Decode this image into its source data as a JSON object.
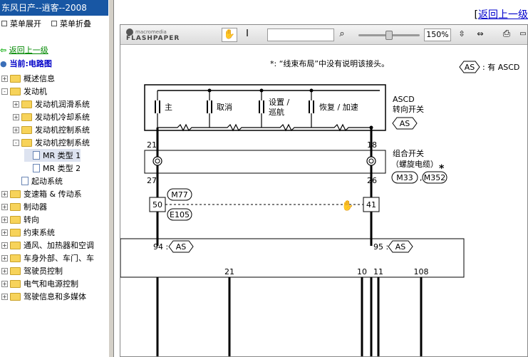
{
  "sidebar": {
    "title": "东风日产--逍客--2008",
    "expand_all": "菜单展开",
    "collapse_all": "菜单折叠",
    "back": "返回上一级",
    "current": "当前:电路图",
    "tree": [
      {
        "label": "概述信息",
        "sign": "+"
      },
      {
        "label": "发动机",
        "sign": "-"
      },
      {
        "label": "发动机润滑系统",
        "sign": "+"
      },
      {
        "label": "发动机冷却系统",
        "sign": "+"
      },
      {
        "label": "发动机控制系统",
        "sign": "+"
      },
      {
        "label": "发动机控制系统",
        "sign": "-"
      },
      {
        "label": "MR 类型 1"
      },
      {
        "label": "MR 类型 2"
      },
      {
        "label": "起动系统"
      },
      {
        "label": "变速箱 & 传动系",
        "sign": "+"
      },
      {
        "label": "制动器",
        "sign": "+"
      },
      {
        "label": "转向",
        "sign": "+"
      },
      {
        "label": "约束系统",
        "sign": "+"
      },
      {
        "label": "通风、加热器和空调",
        "sign": "+"
      },
      {
        "label": "车身外部、车门、车",
        "sign": "+"
      },
      {
        "label": "驾驶员控制",
        "sign": "+"
      },
      {
        "label": "电气和电源控制",
        "sign": "+"
      },
      {
        "label": "驾驶信息和多媒体",
        "sign": "+"
      }
    ]
  },
  "header": {
    "bracket": "[",
    "back_link": "返回上一级"
  },
  "flashpaper": {
    "logo_top": "macromedia",
    "logo_bottom": "FLASHPAPER",
    "zoom": "150%",
    "icons": [
      "hand-tool-icon",
      "text-select-icon",
      "search-icon",
      "fit-width-icon",
      "fit-page-icon",
      "print-icon"
    ]
  },
  "diagram": {
    "note": "*: “线束布局”中没有说明该接头。",
    "legend_tag": "AS",
    "legend_text": ": 有 ASCD",
    "switch_labels": [
      "主",
      "取消",
      "设置 /",
      "巡航",
      "恢复 / 加速"
    ],
    "ascd_label_1": "ASCD",
    "ascd_label_2": "转向开关",
    "ascd_tag": "AS",
    "combo_label_1": "组合开关",
    "combo_label_2": "（螺旋电缆）",
    "combo_conn_1": "M33",
    "combo_conn_2": "M352",
    "combo_star": "*",
    "pins_top": [
      "21",
      "18"
    ],
    "pins_bottom": [
      "27",
      "26"
    ],
    "conn_M77": "M77",
    "conn_E105": "E105",
    "term_left": "50",
    "term_right": "41",
    "ecm_left_pin": "94 :",
    "ecm_left_tag": "AS",
    "ecm_right_pin": "95 :",
    "ecm_right_tag": "AS",
    "bottom_pins": [
      "21",
      "10",
      "11",
      "108"
    ]
  }
}
